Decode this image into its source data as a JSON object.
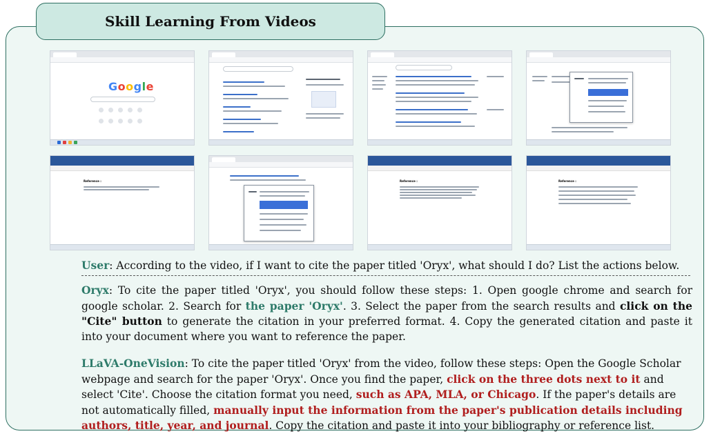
{
  "title": "Skill Learning From Videos",
  "frames": [
    {
      "kind": "google-home",
      "logo": "Google"
    },
    {
      "kind": "search-results"
    },
    {
      "kind": "scholar-results"
    },
    {
      "kind": "scholar-cite"
    },
    {
      "kind": "word-doc",
      "heading": "Reference :"
    },
    {
      "kind": "scholar-cite-popup"
    },
    {
      "kind": "word-doc",
      "heading": "Reference :"
    },
    {
      "kind": "word-doc",
      "heading": "Reference :"
    }
  ],
  "user": {
    "speaker": "User",
    "text": ": According to the video, if I want to cite the paper titled 'Oryx', what should I do? List the actions below."
  },
  "oryx": {
    "speaker": "Oryx",
    "t1": ": To cite the paper titled 'Oryx', you should follow these steps: 1. Open google chrome and search for google scholar. 2. Search for ",
    "h1": "the paper 'Oryx'",
    "t2": ". 3. Select the paper from the search results and ",
    "b1": "click on the \"Cite\" button",
    "t3": " to generate the citation in your preferred format. 4. Copy the generated citation and paste it into your document where you want to reference the paper."
  },
  "llava": {
    "speaker": "LLaVA-OneVision",
    "t1": ": To cite the paper titled 'Oryx' from the video, follow these steps: Open the Google Scholar webpage and search for the paper 'Oryx'. Once you find the paper, ",
    "r1": "click on the three dots next to it",
    "t2": " and select 'Cite'. Choose the citation format you need, ",
    "r2": "such as APA, MLA, or Chicago",
    "t3": ". If the paper's details are not automatically filled, ",
    "r3": "manually input the information from the paper's publication details including authors, title, year, and journal",
    "t4": ". Copy the citation and paste it into your bibliography or reference list."
  },
  "colors": {
    "accent": "#2e7b6a",
    "red": "#b01e1e",
    "panel": "#eef7f4",
    "tab": "#cde9e2"
  }
}
